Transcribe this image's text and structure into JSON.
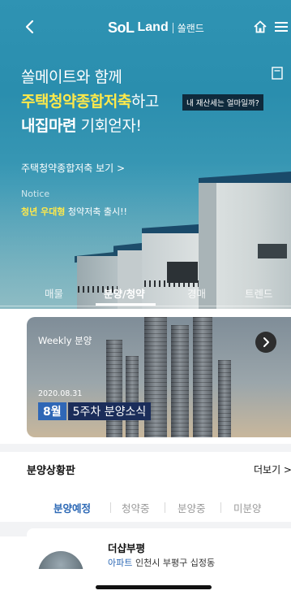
{
  "header": {
    "logo_sol": "SoL",
    "logo_land": "Land",
    "logo_ko": "쏠랜드"
  },
  "hero": {
    "line1": "쏠메이트와 함께",
    "line2_highlight": "주택청약종합저축",
    "line2_rest": "하고",
    "line3_bold": "내집마련",
    "line3_rest": " 기회얻자!",
    "tooltip": "내 재산세는 얼마일까?",
    "view_link": "주택청약종합저축 보기 >",
    "notice_label": "Notice",
    "notice_highlight": "청년 우대형",
    "notice_rest": " 청약저축 출시!!"
  },
  "tabs": [
    {
      "label": "매물"
    },
    {
      "label": "분양/청약"
    },
    {
      "label": "경매"
    },
    {
      "label": "트렌드"
    }
  ],
  "weekly": {
    "label": "Weekly 분양",
    "date": "2020.08.31",
    "month": "8월",
    "week": "5주차 분양소식"
  },
  "board": {
    "title": "분양상황판",
    "more": "더보기 >",
    "subtabs": [
      {
        "label": "분양예정"
      },
      {
        "label": "청약중"
      },
      {
        "label": "분양중"
      },
      {
        "label": "미분양"
      }
    ]
  },
  "item": {
    "name": "더샵부평",
    "type": "아파트",
    "address": "인천시 부평구 십정동"
  },
  "colors": {
    "accent_yellow": "#ffe94a",
    "accent_blue": "#2c68b5",
    "hero_teal": "#2f93b3"
  }
}
